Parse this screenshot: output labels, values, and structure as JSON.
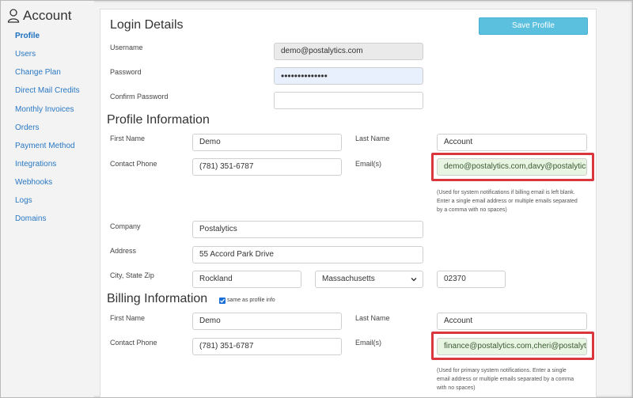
{
  "sidebar": {
    "title": "Account",
    "items": [
      {
        "label": "Profile",
        "active": true
      },
      {
        "label": "Users"
      },
      {
        "label": "Change Plan"
      },
      {
        "label": "Direct Mail Credits"
      },
      {
        "label": "Monthly Invoices"
      },
      {
        "label": "Orders"
      },
      {
        "label": "Payment Method"
      },
      {
        "label": "Integrations"
      },
      {
        "label": "Webhooks"
      },
      {
        "label": "Logs"
      },
      {
        "label": "Domains"
      }
    ]
  },
  "login": {
    "heading": "Login Details",
    "save_label": "Save Profile",
    "username_label": "Username",
    "username_value": "demo@postalytics.com",
    "password_label": "Password",
    "password_value": "••••••••••••••",
    "confirm_label": "Confirm Password",
    "confirm_value": ""
  },
  "profile": {
    "heading": "Profile Information",
    "first_name_label": "First Name",
    "first_name_value": "Demo",
    "last_name_label": "Last Name",
    "last_name_value": "Account",
    "phone_label": "Contact Phone",
    "phone_value": "(781) 351-6787",
    "email_label": "Email(s)",
    "email_value": "demo@postalytics.com,davy@postalytics.c",
    "email_help_1": "(Used for system notifications if billing email is left blank.",
    "email_help_2": "Enter a single email address or multiple emails separated",
    "email_help_3": "by a comma with no spaces)",
    "company_label": "Company",
    "company_value": "Postalytics",
    "address_label": "Address",
    "address_value": "55 Accord Park Drive",
    "csz_label": "City, State Zip",
    "city_value": "Rockland",
    "state_value": "Massachusetts",
    "zip_value": "02370"
  },
  "billing": {
    "heading": "Billing Information",
    "same_as_label": "same as profile info",
    "same_as_checked": true,
    "first_name_label": "First Name",
    "first_name_value": "Demo",
    "last_name_label": "Last Name",
    "last_name_value": "Account",
    "phone_label": "Contact Phone",
    "phone_value": "(781) 351-6787",
    "email_label": "Email(s)",
    "email_value": "finance@postalytics.com,cheri@postalytic",
    "email_help_1": "(Used for primary system notifications. Enter a single",
    "email_help_2": "email address or multiple emails separated by a comma",
    "email_help_3": "with no spaces)"
  },
  "colors": {
    "accent_button": "#5bc0de",
    "highlight": "#d9363e",
    "link": "#2a78c3"
  }
}
